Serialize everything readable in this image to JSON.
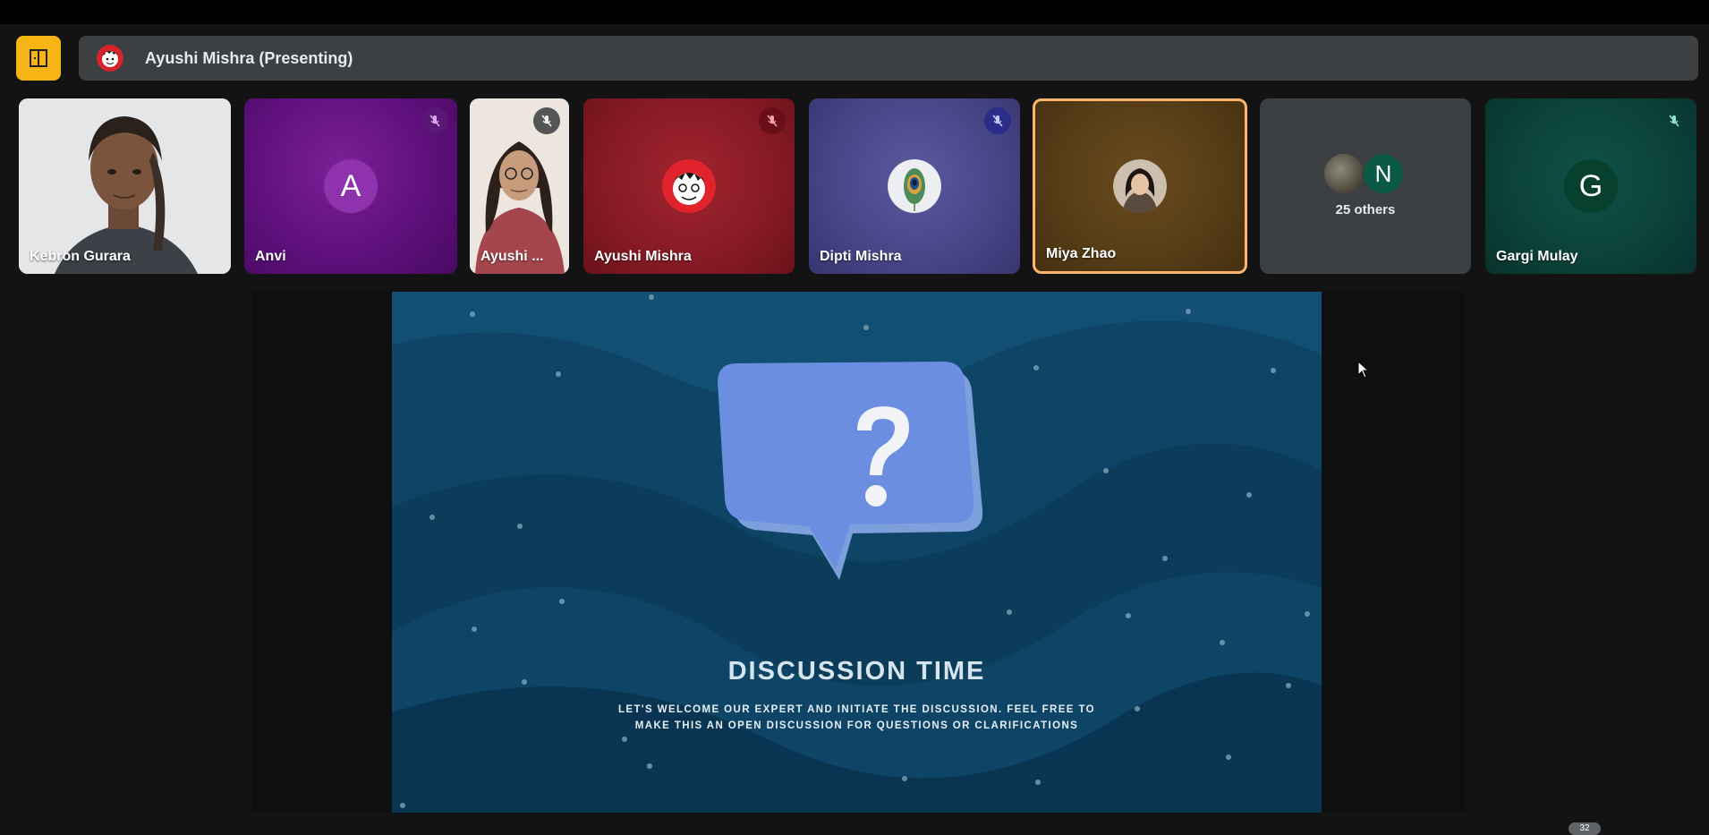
{
  "presenting": {
    "label": "Ayushi Mishra (Presenting)"
  },
  "tiles": [
    {
      "name": "Kebron Gurara"
    },
    {
      "name": "Anvi",
      "letter": "A",
      "muted": true
    },
    {
      "name": "Ayushi ...",
      "muted": true
    },
    {
      "name": "Ayushi Mishra",
      "muted": true
    },
    {
      "name": "Dipti Mishra",
      "muted": true
    },
    {
      "name": "Miya Zhao",
      "active_speaker": true
    },
    {
      "others_label": "25 others",
      "others_letter": "N"
    },
    {
      "name": "Gargi Mulay",
      "letter": "G",
      "muted": true
    }
  ],
  "slide": {
    "title": "DISCUSSION TIME",
    "subtitle_line1": "LET'S WELCOME OUR EXPERT AND INITIATE THE DISCUSSION. FEEL FREE TO",
    "subtitle_line2": "MAKE THIS AN OPEN DISCUSSION FOR QUESTIONS OR CLARIFICATIONS"
  },
  "bottom_badge": "32",
  "colors": {
    "accent": "#f7b515",
    "active_speaker_border": "#fdb56b",
    "slide_bg": "#0e4566"
  }
}
